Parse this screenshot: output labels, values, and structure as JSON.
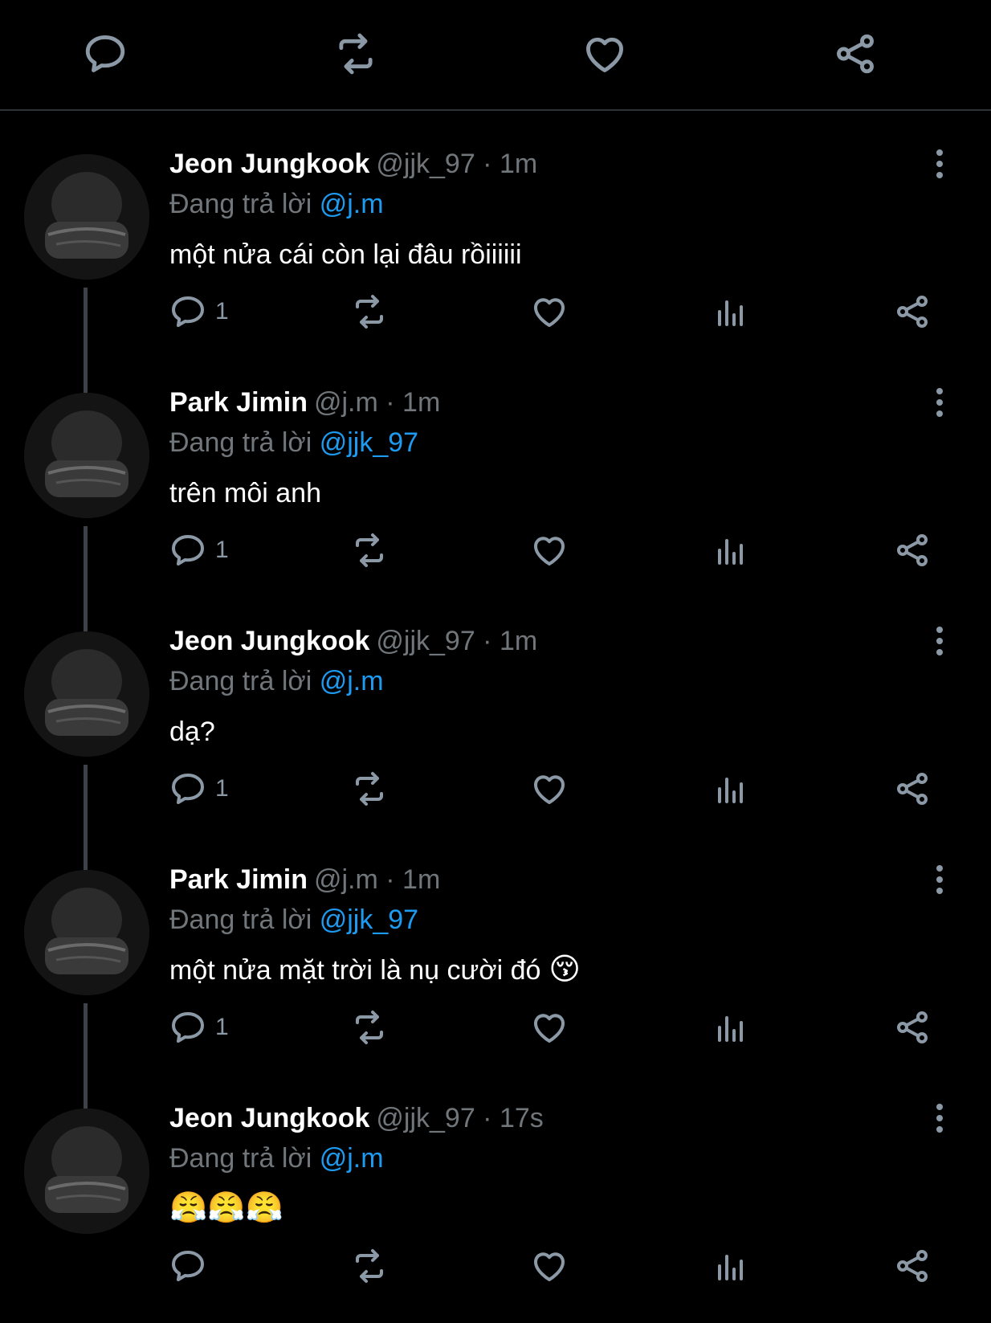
{
  "topbar": {
    "icons": [
      "reply-icon",
      "retweet-icon",
      "like-icon",
      "share-icon"
    ]
  },
  "colors": {
    "background": "#000000",
    "text": "#ffffff",
    "muted": "#71767b",
    "icon": "#8b98a5",
    "accent": "#1d9bf0",
    "divider": "#2f3336"
  },
  "replying_prefix": "Đang trả lời",
  "tweets": [
    {
      "name": "Jeon Jungkook",
      "meta": "@jjk_97 · 1m",
      "reply_to": "@j.m",
      "text": "một nửa cái còn lại đâu rồiiiiii",
      "reply_count": "1",
      "avatar": "jungkook-avatar"
    },
    {
      "name": "Park Jimin",
      "meta": "@j.m · 1m",
      "reply_to": "@jjk_97",
      "text": "trên môi anh",
      "reply_count": "1",
      "avatar": "jimin-avatar"
    },
    {
      "name": "Jeon Jungkook",
      "meta": "@jjk_97 · 1m",
      "reply_to": "@j.m",
      "text": "dạ?",
      "reply_count": "1",
      "avatar": "jungkook-avatar"
    },
    {
      "name": "Park Jimin",
      "meta": "@j.m · 1m",
      "reply_to": "@jjk_97",
      "text": "một nửa mặt trời là nụ cười đó",
      "emoji": "😚",
      "reply_count": "1",
      "avatar": "jimin-avatar"
    },
    {
      "name": "Jeon Jungkook",
      "meta": "@jjk_97 · 17s",
      "reply_to": "@j.m",
      "text": "",
      "emoji": "😤😤😤",
      "reply_count": "",
      "avatar": "jungkook-avatar"
    }
  ]
}
